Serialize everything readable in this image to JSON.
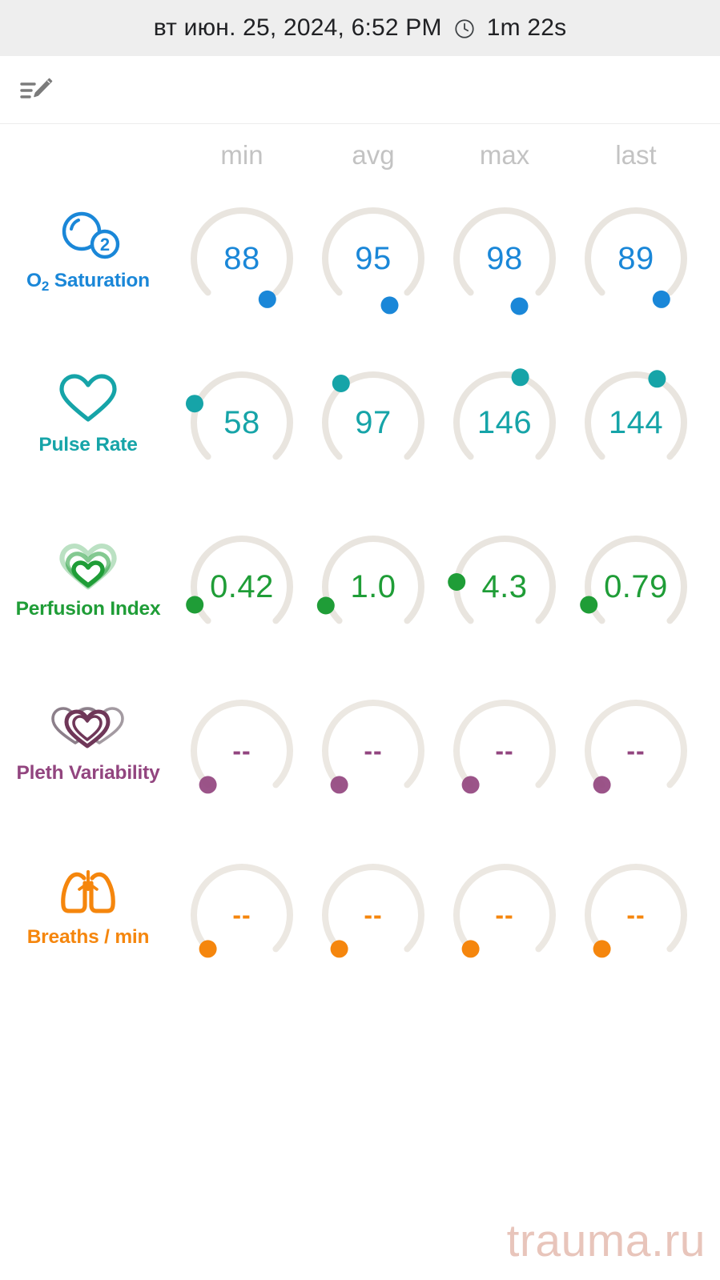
{
  "header": {
    "datetime": "вт июн. 25, 2024, 6:52 PM",
    "clock_icon": "clock-icon",
    "duration": "1m 22s",
    "background": "#eeeeee"
  },
  "toolbar": {
    "edit_icon": "edit-note-icon"
  },
  "columns": [
    {
      "label": "min"
    },
    {
      "label": "avg"
    },
    {
      "label": "max"
    },
    {
      "label": "last"
    }
  ],
  "metrics": [
    {
      "id": "o2-saturation",
      "name": "O",
      "name_sub": "2",
      "name_rest": " Saturation",
      "icon": "oxygen-bubbles-icon",
      "color": "#1a87d8",
      "values": [
        "88",
        "95",
        "98",
        "89"
      ],
      "dot_angles": [
        58,
        70,
        72,
        58
      ]
    },
    {
      "id": "pulse-rate",
      "name": "Pulse Rate",
      "icon": "heart-outline-icon",
      "color": "#16a4a8",
      "values": [
        "58",
        "97",
        "146",
        "144"
      ],
      "dot_angles": [
        -68,
        -48,
        -19,
        -12
      ]
    },
    {
      "id": "perfusion-index",
      "name": "Perfusion Index",
      "icon": "nested-hearts-icon",
      "color": "#1f9d37",
      "values": [
        "0.42",
        "1.0",
        "4.3",
        "0.79"
      ],
      "dot_angles": [
        -112,
        -113,
        -86,
        -112
      ]
    },
    {
      "id": "pleth-variability",
      "name": "Pleth Variability",
      "icon": "overlapping-hearts-icon",
      "color": "#92457f",
      "values": [
        "--",
        "--",
        "--",
        "--"
      ],
      "dot_angles": [
        -125,
        -125,
        -125,
        -125
      ]
    },
    {
      "id": "breaths-per-min",
      "name": "Breaths / min",
      "icon": "lungs-icon",
      "color": "#f5860d",
      "values": [
        "--",
        "--",
        "--",
        "--"
      ],
      "dot_angles": [
        -125,
        -125,
        -125,
        -125
      ]
    }
  ],
  "watermark": {
    "text": "trauma.ru",
    "color": "#e8c5bb"
  },
  "theme": {
    "gauge_track": "#e9e5df",
    "column_header_color": "#c3c3c3",
    "title_color": "#202124"
  }
}
